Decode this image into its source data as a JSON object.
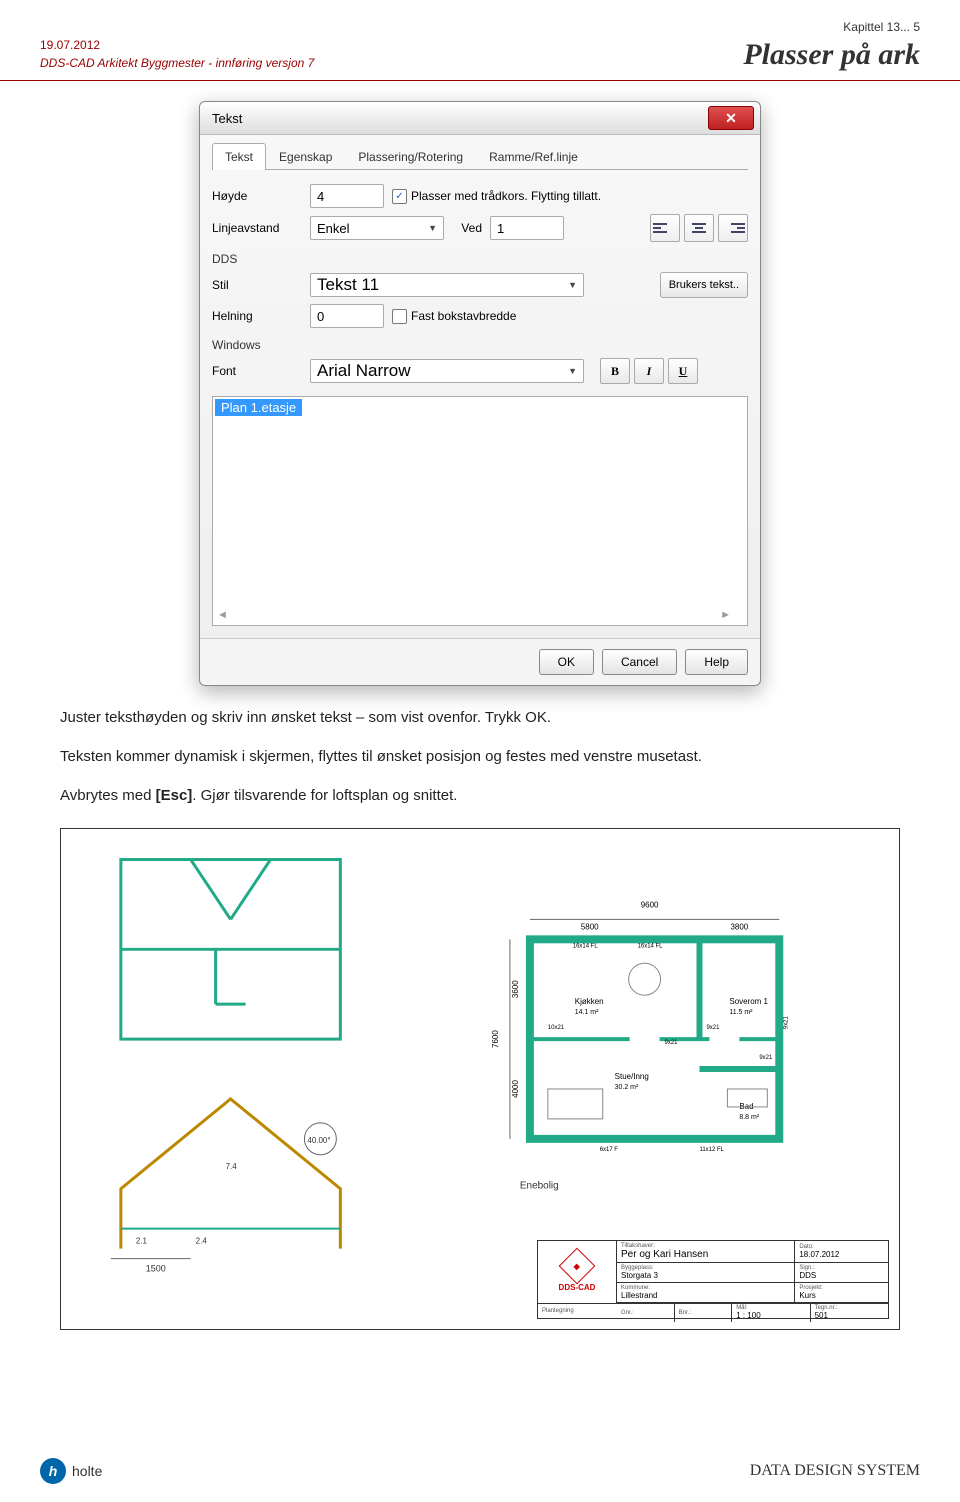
{
  "header": {
    "date": "19.07.2012",
    "subtitle": "DDS-CAD Arkitekt Byggmester -  innføring versjon 7",
    "chapter": "Kapittel 13... 5",
    "page_title": "Plasser på ark"
  },
  "dialog": {
    "title": "Tekst",
    "tabs": [
      "Tekst",
      "Egenskap",
      "Plassering/Rotering",
      "Ramme/Ref.linje"
    ],
    "active_tab": 0,
    "fields": {
      "hoyde_label": "Høyde",
      "hoyde_value": "4",
      "plasser_checkbox_label": "Plasser med trådkors. Flytting tillatt.",
      "plasser_checked": true,
      "linjeavstand_label": "Linjeavstand",
      "linjeavstand_value": "Enkel",
      "ved_label": "Ved",
      "ved_value": "1",
      "group_dds": "DDS",
      "stil_label": "Stil",
      "stil_value": "Tekst 11",
      "brukers_tekst_btn": "Brukers tekst..",
      "helning_label": "Helning",
      "helning_value": "0",
      "fast_bokstav_label": "Fast bokstavbredde",
      "fast_bokstav_checked": false,
      "group_windows": "Windows",
      "font_label": "Font",
      "font_value": "Arial Narrow",
      "bold": "B",
      "italic": "I",
      "underline": "U",
      "textarea_value": "Plan 1.etasje"
    },
    "buttons": {
      "ok": "OK",
      "cancel": "Cancel",
      "help": "Help"
    }
  },
  "body_text": {
    "p1": "Juster teksthøyden og skriv inn ønsket tekst – som vist ovenfor. Trykk OK.",
    "p2": "Teksten kommer dynamisk i skjermen, flyttes til ønsket posisjon og festes med venstre musetast.",
    "p3a": "Avbrytes med ",
    "p3b": "[Esc]",
    "p3c": ".  Gjør tilsvarende for loftsplan og snittet."
  },
  "drawing": {
    "section_angle": "40.00°",
    "section_width": "1500",
    "section_marks": [
      "2.1",
      "2.4",
      "7.4"
    ],
    "plan": {
      "total_width": "9600",
      "dim_left": "5800",
      "dim_right": "3800",
      "total_height": "7600",
      "dim_top": "3600",
      "dim_bottom": "4000",
      "rooms": {
        "kjokken": {
          "name": "Kjøkken",
          "area": "14.1 m²"
        },
        "soverom1": {
          "name": "Soverom 1",
          "area": "11.5 m²"
        },
        "stue": {
          "name": "Stue/Inng",
          "area": "30.2 m²"
        },
        "bad": {
          "name": "Bad",
          "area": "8.8 m²"
        }
      },
      "windows": [
        "16x14 FL",
        "16x14 FL",
        "10x21",
        "9x21",
        "9x21",
        "9x21",
        "9x21",
        "6x17 F",
        "11x12 FL"
      ]
    },
    "building_type": "Enebolig",
    "scale_label": "1 : 100"
  },
  "title_block": {
    "logo": "DDS-CAD",
    "tiltakshaver": {
      "lbl": "Tiltakshaver:",
      "val": "Per og Kari Hansen"
    },
    "byggeplass": {
      "lbl": "Byggeplass:",
      "val": "Storgata 3"
    },
    "kommune": {
      "lbl": "Kommune:",
      "val": "Lillestrand"
    },
    "dato": {
      "lbl": "Dato:",
      "val": "18.07.2012"
    },
    "sign": {
      "lbl": "Sign.:",
      "val": "DDS"
    },
    "prosjekt": {
      "lbl": "Prosjekt:",
      "val": "Kurs"
    },
    "gnr": {
      "lbl": "Gnr.:",
      "val": ""
    },
    "bnr": {
      "lbl": "Bnr.:",
      "val": ""
    },
    "mal": {
      "lbl": "Mål:",
      "val": "1 : 100"
    },
    "tegnnr": {
      "lbl": "Tegn.nr.:",
      "val": "501"
    },
    "plantegning": {
      "lbl": "Plantegning",
      "val": ""
    }
  },
  "footer": {
    "holte": "holte",
    "dds": "DATA DESIGN SYSTEM"
  }
}
